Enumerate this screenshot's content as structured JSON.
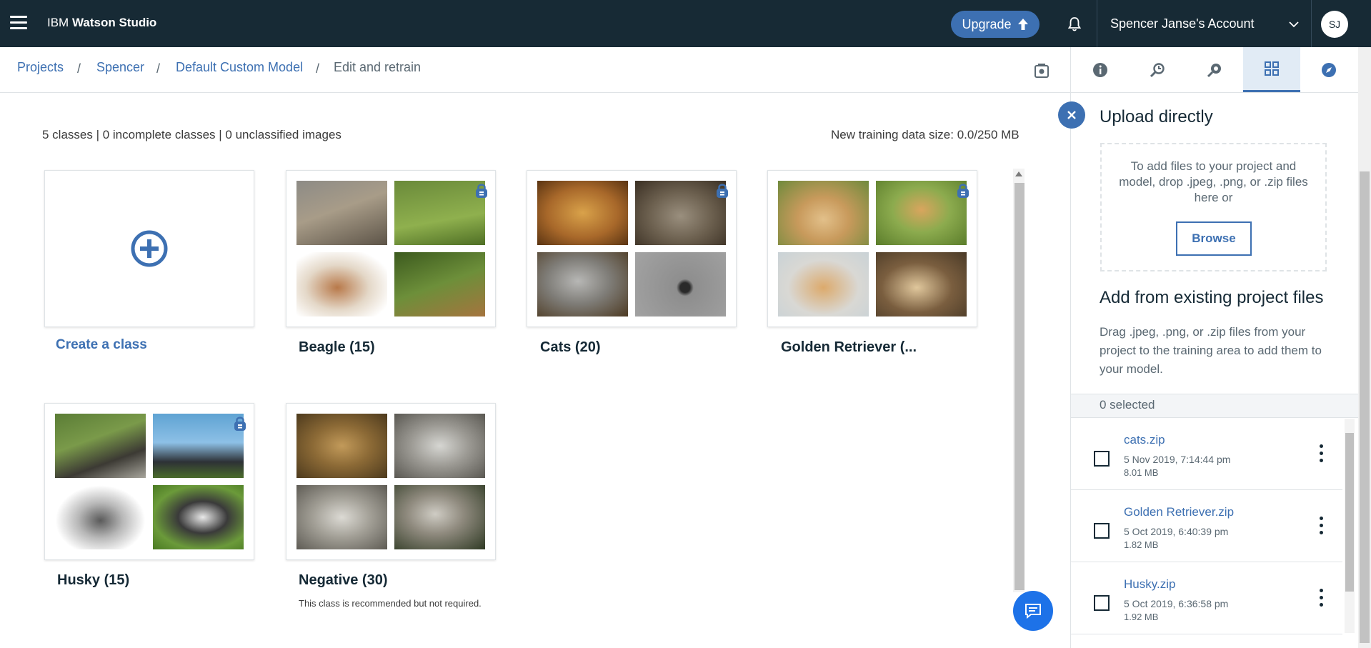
{
  "app": {
    "brand_prefix": "IBM",
    "brand_name": "Watson Studio"
  },
  "topbar": {
    "upgrade_label": "Upgrade",
    "account_name": "Spencer Janse's Account",
    "avatar_initials": "SJ"
  },
  "breadcrumb": [
    {
      "label": "Projects"
    },
    {
      "label": "Spencer"
    },
    {
      "label": "Default Custom Model"
    },
    {
      "label": "Edit and retrain"
    }
  ],
  "breadcrumb_sep": "/",
  "tabs": [
    {
      "icon": "info-icon"
    },
    {
      "icon": "search-model-icon"
    },
    {
      "icon": "find-icon"
    },
    {
      "icon": "data-grid-icon",
      "active": true
    },
    {
      "icon": "compass-icon"
    }
  ],
  "main": {
    "summary": "5 classes | 0 incomplete classes | 0 unclassified images",
    "data_size": "New training data size: 0.0/250 MB",
    "create_label": "Create a class",
    "classes": [
      {
        "title": "Beagle (15)"
      },
      {
        "title": "Cats (20)"
      },
      {
        "title": "Golden Retriever (..."
      },
      {
        "title": "Husky (15)"
      },
      {
        "title": "Negative (30)",
        "note": "This class is recommended but not required."
      }
    ]
  },
  "panel": {
    "upload_title": "Upload directly",
    "drop_text": "To add files to your project and model, drop .jpeg, .png, or .zip files here or",
    "browse_label": "Browse",
    "add_title": "Add from existing project files",
    "add_desc": "Drag .jpeg, .png, or .zip files from your project to the training area to add them to your model.",
    "selected_text": "0 selected",
    "files": [
      {
        "name": "cats.zip",
        "date": "5 Nov 2019, 7:14:44 pm",
        "size": "8.01 MB"
      },
      {
        "name": "Golden Retriever.zip",
        "date": "5 Oct 2019, 6:40:39 pm",
        "size": "1.82 MB"
      },
      {
        "name": "Husky.zip",
        "date": "5 Oct 2019, 6:36:58 pm",
        "size": "1.92 MB"
      }
    ]
  },
  "colors": {
    "topbar": "#172a35",
    "accent": "#3d70b2",
    "chat": "#1d72e8"
  }
}
